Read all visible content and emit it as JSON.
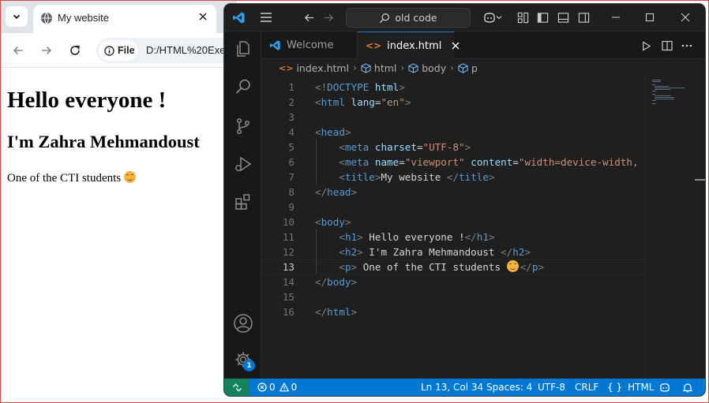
{
  "browser": {
    "tab_title": "My website",
    "chip_label": "File",
    "url": "D:/HTML%20Exe",
    "page": {
      "h1": "Hello everyone !",
      "h2": "I'm Zahra Mehmandoust",
      "p": "One of the CTI students"
    }
  },
  "vscode": {
    "search_text": "old code",
    "tabs": [
      {
        "label": "Welcome",
        "icon": "vscode-logo-icon",
        "active": false
      },
      {
        "label": "index.html",
        "icon": "html-file-icon",
        "active": true
      }
    ],
    "breadcrumbs": [
      "index.html",
      "html",
      "body",
      "p"
    ],
    "code_lines": [
      {
        "n": "1",
        "tokens": [
          [
            "tg",
            "<!"
          ],
          [
            "tn",
            "DOCTYPE"
          ],
          [
            "tx",
            " "
          ],
          [
            "at",
            "html"
          ],
          [
            "tg",
            ">"
          ]
        ]
      },
      {
        "n": "2",
        "tokens": [
          [
            "tg",
            "<"
          ],
          [
            "tn",
            "html"
          ],
          [
            "tx",
            " "
          ],
          [
            "at",
            "lang"
          ],
          [
            "tx",
            "="
          ],
          [
            "av",
            "\"en\""
          ],
          [
            "tg",
            ">"
          ]
        ]
      },
      {
        "n": "3",
        "tokens": []
      },
      {
        "n": "4",
        "tokens": [
          [
            "tg",
            "<"
          ],
          [
            "tn",
            "head"
          ],
          [
            "tg",
            ">"
          ]
        ]
      },
      {
        "n": "5",
        "tokens": [
          [
            "tx",
            "    "
          ],
          [
            "tg",
            "<"
          ],
          [
            "tn",
            "meta"
          ],
          [
            "tx",
            " "
          ],
          [
            "at",
            "charset"
          ],
          [
            "tx",
            "="
          ],
          [
            "av",
            "\"UTF-8\""
          ],
          [
            "tg",
            ">"
          ]
        ]
      },
      {
        "n": "6",
        "tokens": [
          [
            "tx",
            "    "
          ],
          [
            "tg",
            "<"
          ],
          [
            "tn",
            "meta"
          ],
          [
            "tx",
            " "
          ],
          [
            "at",
            "name"
          ],
          [
            "tx",
            "="
          ],
          [
            "av",
            "\"viewport\""
          ],
          [
            "tx",
            " "
          ],
          [
            "at",
            "content"
          ],
          [
            "tx",
            "="
          ],
          [
            "av",
            "\"width=device-width,"
          ]
        ]
      },
      {
        "n": "7",
        "tokens": [
          [
            "tx",
            "    "
          ],
          [
            "tg",
            "<"
          ],
          [
            "tn",
            "title"
          ],
          [
            "tg",
            ">"
          ],
          [
            "tx",
            "My website "
          ],
          [
            "tg",
            "</"
          ],
          [
            "tn",
            "title"
          ],
          [
            "tg",
            ">"
          ]
        ]
      },
      {
        "n": "8",
        "tokens": [
          [
            "tg",
            "</"
          ],
          [
            "tn",
            "head"
          ],
          [
            "tg",
            ">"
          ]
        ]
      },
      {
        "n": "9",
        "tokens": []
      },
      {
        "n": "10",
        "tokens": [
          [
            "tg",
            "<"
          ],
          [
            "tn",
            "body"
          ],
          [
            "tg",
            ">"
          ]
        ]
      },
      {
        "n": "11",
        "tokens": [
          [
            "tx",
            "    "
          ],
          [
            "tg",
            "<"
          ],
          [
            "tn",
            "h1"
          ],
          [
            "tg",
            ">"
          ],
          [
            "tx",
            " Hello everyone !"
          ],
          [
            "tg",
            "</"
          ],
          [
            "tn",
            "h1"
          ],
          [
            "tg",
            ">"
          ]
        ]
      },
      {
        "n": "12",
        "tokens": [
          [
            "tx",
            "    "
          ],
          [
            "tg",
            "<"
          ],
          [
            "tn",
            "h2"
          ],
          [
            "tg",
            ">"
          ],
          [
            "tx",
            " I'm Zahra Mehmandoust "
          ],
          [
            "tg",
            "</"
          ],
          [
            "tn",
            "h2"
          ],
          [
            "tg",
            ">"
          ]
        ]
      },
      {
        "n": "13",
        "tokens": [
          [
            "tx",
            "    "
          ],
          [
            "tg",
            "<"
          ],
          [
            "tn",
            "p"
          ],
          [
            "tg",
            ">"
          ],
          [
            "tx",
            " One of the CTI students "
          ],
          [
            "emoji",
            ""
          ],
          [
            "tg",
            "</"
          ],
          [
            "tn",
            "p"
          ],
          [
            "tg",
            ">"
          ]
        ]
      },
      {
        "n": "14",
        "tokens": [
          [
            "tg",
            "</"
          ],
          [
            "tn",
            "body"
          ],
          [
            "tg",
            ">"
          ]
        ]
      },
      {
        "n": "15",
        "tokens": []
      },
      {
        "n": "16",
        "tokens": [
          [
            "tg",
            "</"
          ],
          [
            "tn",
            "html"
          ],
          [
            "tg",
            ">"
          ]
        ]
      }
    ],
    "current_line": "13",
    "accounts_badge": "1",
    "status": {
      "errors": "0",
      "warnings": "0",
      "position": "Ln 13, Col 34",
      "spaces": "Spaces: 4",
      "encoding": "UTF-8",
      "eol": "CRLF",
      "language_braces": "{ }",
      "language": "HTML"
    },
    "colors": {
      "accent": "#0078d4",
      "remote": "#16825d",
      "background": "#1f1f1f"
    }
  }
}
